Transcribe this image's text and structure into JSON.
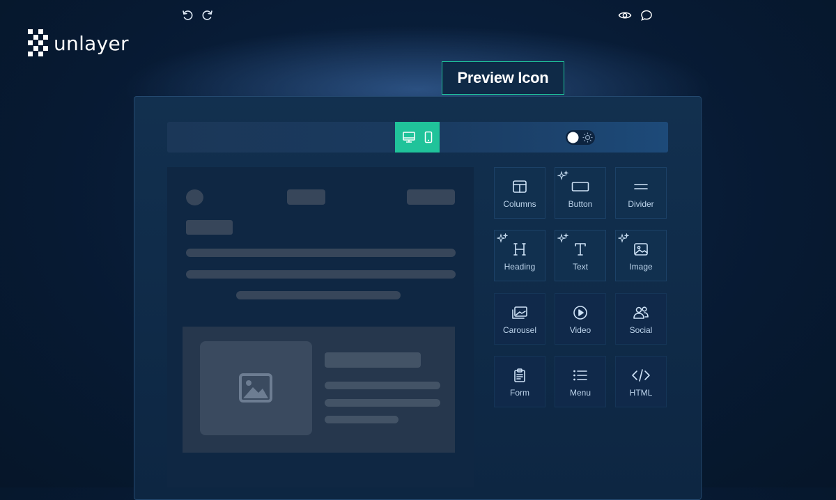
{
  "brand": {
    "name": "unlayer"
  },
  "callout": {
    "label": "Preview Icon",
    "accent": "#1fc49b"
  },
  "toolbar": {
    "undo_icon": "undo-icon",
    "redo_icon": "redo-icon",
    "device_buttons": [
      "desktop-icon",
      "mobile-icon"
    ],
    "device_accent": "#20c39a",
    "theme_toggle": [
      "moon-icon",
      "sun-icon"
    ],
    "right_icons": [
      "eye-icon",
      "comment-icon"
    ]
  },
  "tools": [
    {
      "label": "Columns",
      "icon": "columns-icon",
      "ai": false
    },
    {
      "label": "Button",
      "icon": "button-icon",
      "ai": true
    },
    {
      "label": "Divider",
      "icon": "divider-icon",
      "ai": false
    },
    {
      "label": "Heading",
      "icon": "heading-icon",
      "ai": true
    },
    {
      "label": "Text",
      "icon": "text-icon",
      "ai": true
    },
    {
      "label": "Image",
      "icon": "image-icon",
      "ai": true
    },
    {
      "label": "Carousel",
      "icon": "carousel-icon",
      "ai": false
    },
    {
      "label": "Video",
      "icon": "video-icon",
      "ai": false
    },
    {
      "label": "Social",
      "icon": "social-icon",
      "ai": false
    },
    {
      "label": "Form",
      "icon": "form-icon",
      "ai": false
    },
    {
      "label": "Menu",
      "icon": "menu-icon",
      "ai": false
    },
    {
      "label": "HTML",
      "icon": "html-icon",
      "ai": false
    }
  ]
}
